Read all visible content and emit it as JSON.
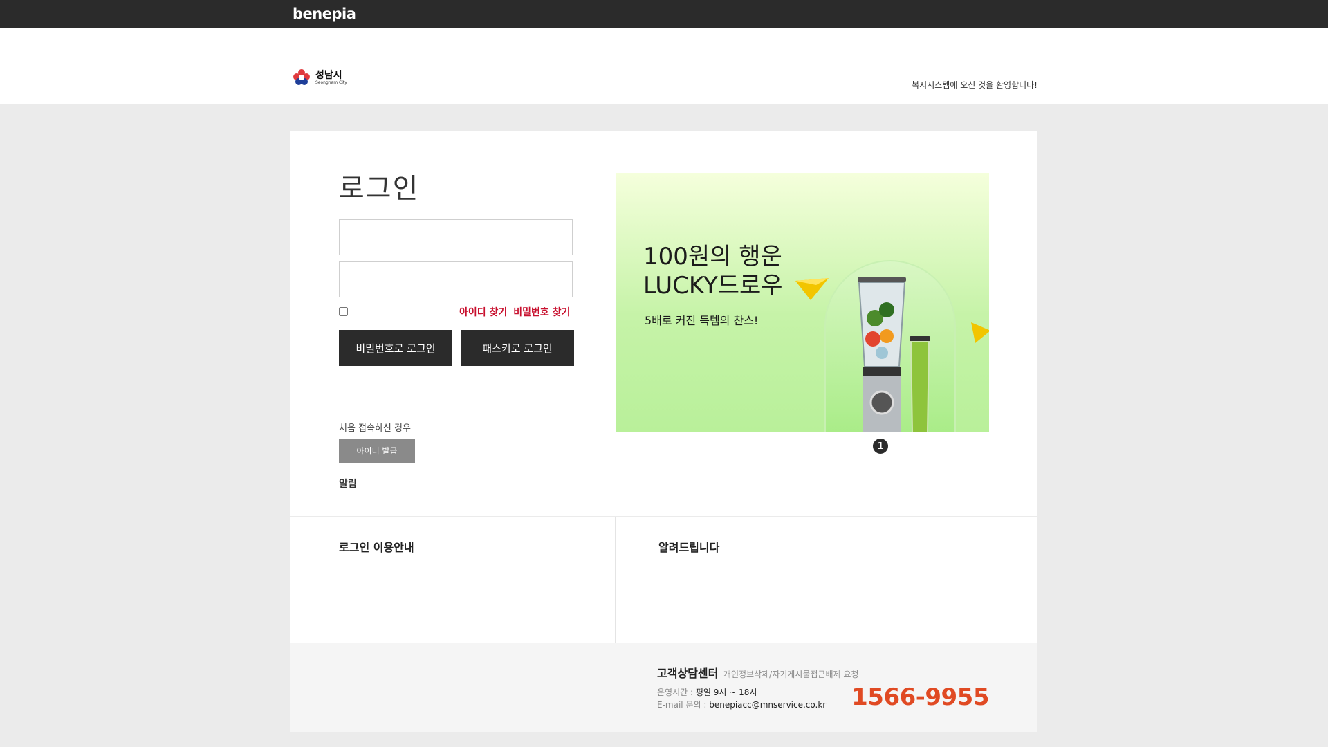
{
  "topbar": {
    "brand": "benepia"
  },
  "header": {
    "logo": {
      "name_ko": "성남시",
      "name_en": "Seongnam City"
    },
    "welcome": "복지시스템에 오신 것을 환영합니다!"
  },
  "login": {
    "title": "로그인",
    "id_value": "",
    "pw_value": "",
    "find_id": "아이디 찾기",
    "find_pw": "비밀번호 찾기",
    "btn_password_login": "비밀번호로 로그인",
    "btn_passkey_login": "패스키로 로그인",
    "first_visit": "처음 접속하신 경우",
    "btn_issue_id": "아이디 발급",
    "notice": "알림"
  },
  "banner": {
    "line1": "100원의 행운",
    "line2": "LUCKY드로우",
    "sub": "5배로 커진 득템의 찬스!",
    "page_indicator": "1",
    "colors": {
      "bg_top": "#f5ffdc",
      "bg_bottom": "#b9f09a",
      "gem": "#f2c500"
    }
  },
  "info": {
    "left_title": "로그인 이용안내",
    "right_title": "알려드립니다"
  },
  "footer": {
    "cs_title": "고객상담센터",
    "cs_sub": "개인정보삭제/자기게시물접근배제 요청",
    "hours_label": "운영시간 :",
    "hours_value": "평일 9시 ~ 18시",
    "email_label": "E-mail 문의 :",
    "email_value": "benepiacc@mnservice.co.kr",
    "phone": "1566-9955",
    "phone_color": "#e04a23"
  }
}
